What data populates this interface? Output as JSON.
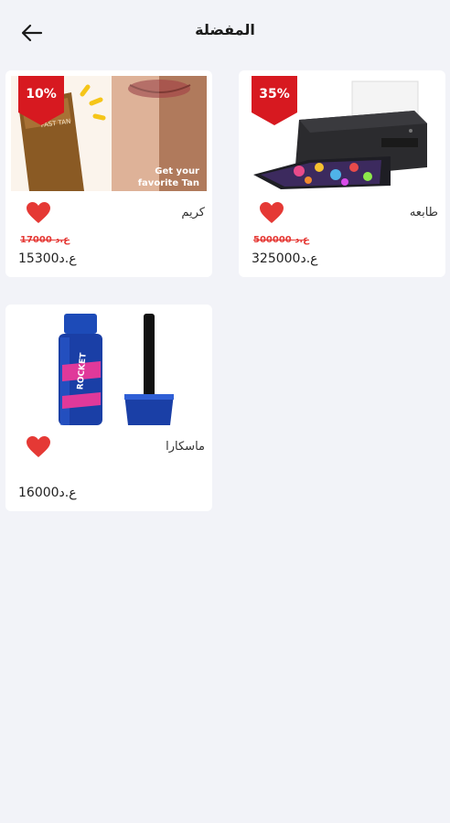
{
  "header": {
    "title": "المفضلة",
    "back_icon": "arrow-left-icon"
  },
  "products": [
    {
      "name": "طابعه",
      "discount": "35%",
      "old_price": "500000 ع.د",
      "currency": "ع.د",
      "price": "325000",
      "favorite": true,
      "image": "printer"
    },
    {
      "name": "كريم",
      "discount": "10%",
      "old_price": "17000 ع.د",
      "currency": "ع.د",
      "price": "15300",
      "favorite": true,
      "image": "tanning-lotion",
      "image_texts": {
        "brand": "FAST TAN",
        "tagline": "Get your favorite Tan"
      }
    },
    {
      "name": "ماسكارا",
      "currency": "ع.د",
      "price": "16000",
      "favorite": true,
      "image": "mascara",
      "image_texts": {
        "brand": "ROCKET"
      }
    }
  ],
  "colors": {
    "accent": "#e53935",
    "badge": "#d71920",
    "background": "#f2f3f8"
  }
}
